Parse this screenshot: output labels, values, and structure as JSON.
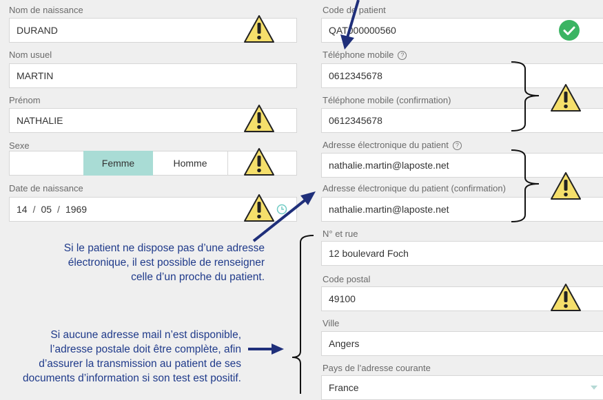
{
  "left": {
    "birth_name": {
      "label": "Nom de naissance",
      "value": "DURAND"
    },
    "usual_name": {
      "label": "Nom usuel",
      "value": "MARTIN"
    },
    "first_name": {
      "label": "Prénom",
      "value": "NATHALIE"
    },
    "sex": {
      "label": "Sexe",
      "options": [
        "Femme",
        "Homme"
      ],
      "selected": "Femme"
    },
    "birth_date": {
      "label": "Date de naissance",
      "day": "14",
      "month": "05",
      "year": "1969",
      "sep": "/"
    }
  },
  "right": {
    "patient_code": {
      "label": "Code de patient",
      "value": "QAT000000560"
    },
    "mobile": {
      "label": "Téléphone mobile",
      "value": "0612345678"
    },
    "mobile_confirm": {
      "label": "Téléphone mobile (confirmation)",
      "value": "0612345678"
    },
    "email": {
      "label": "Adresse électronique du patient",
      "value": "nathalie.martin@laposte.net"
    },
    "email_confirm": {
      "label": "Adresse électronique du patient (confirmation)",
      "value": "nathalie.martin@laposte.net"
    },
    "street": {
      "label": "N° et rue",
      "value": "12 boulevard Foch"
    },
    "postal_code": {
      "label": "Code postal",
      "value": "49100"
    },
    "city": {
      "label": "Ville",
      "value": "Angers"
    },
    "country": {
      "label": "Pays de l’adresse courante",
      "value": "France"
    }
  },
  "annotations": {
    "email_note": [
      "Si le patient ne dispose pas d’une adresse",
      "électronique, il est possible de renseigner",
      "celle d’un proche du patient."
    ],
    "address_note": [
      "Si aucune adresse mail n’est disponible,",
      "l’adresse postale doit être complète, afin",
      "d’assurer la transmission au patient de ses",
      "documents d’information si son test est positif."
    ]
  },
  "colors": {
    "warning": "#f5df6b",
    "note_text": "#1f3a8a",
    "selected_segment": "#a9dcd5",
    "valid_check": "#3bb463"
  },
  "icons": {
    "warning": "warning-triangle-icon",
    "help": "help-circle-icon",
    "valid": "checkmark-icon",
    "clock": "clock-icon",
    "dropdown": "caret-down-icon"
  }
}
